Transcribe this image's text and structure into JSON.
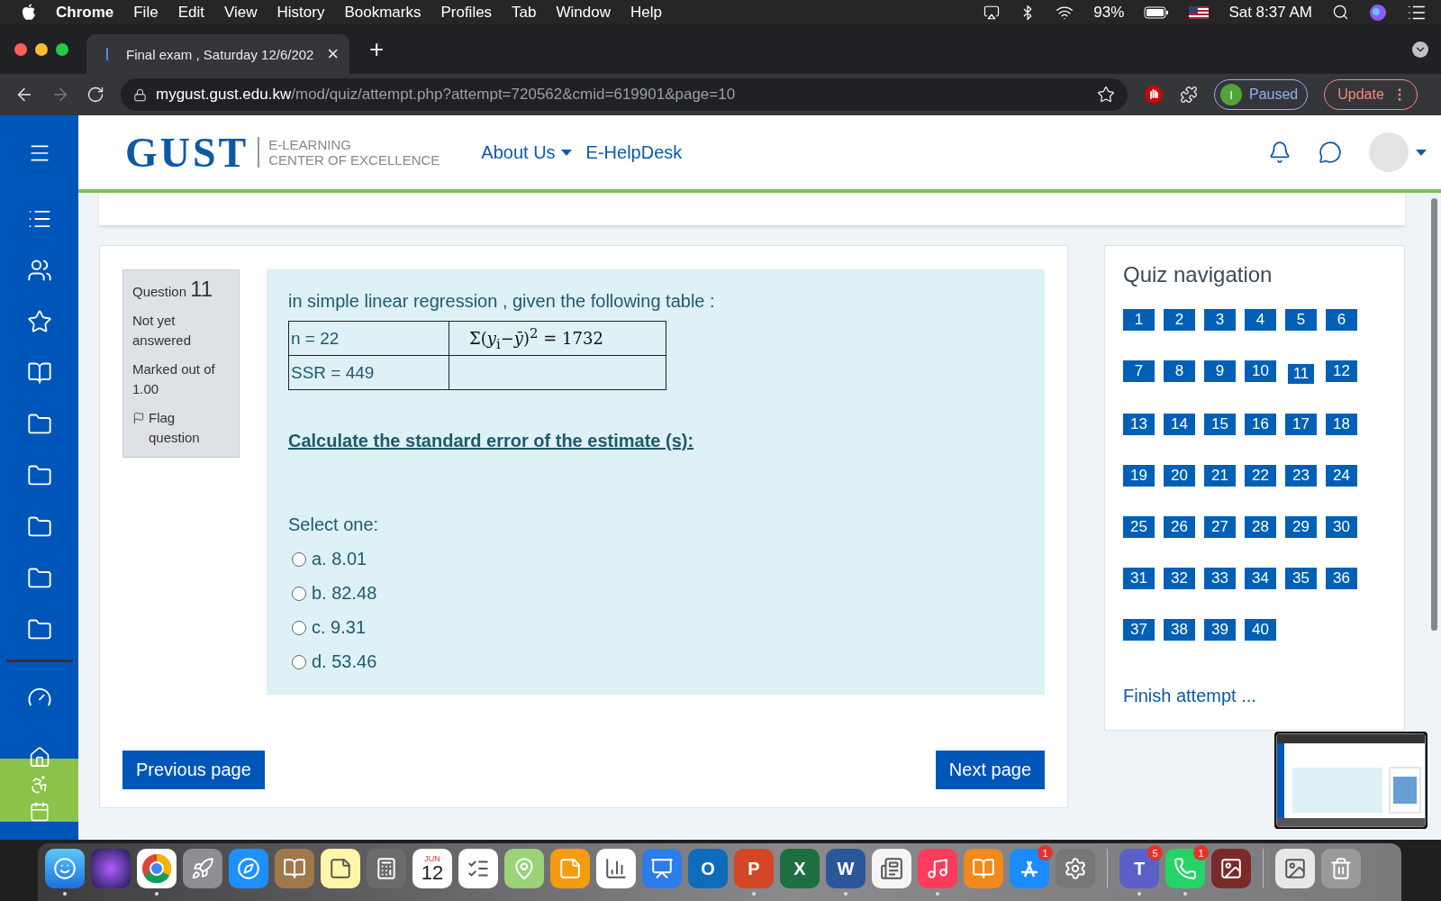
{
  "menu_bar": {
    "app": "Chrome",
    "items": [
      "File",
      "Edit",
      "View",
      "History",
      "Bookmarks",
      "Profiles",
      "Tab",
      "Window",
      "Help"
    ],
    "battery": "93%",
    "clock": "Sat 8:37 AM"
  },
  "browser": {
    "tab": {
      "title": "Final exam , Saturday 12/6/202",
      "close": "×"
    },
    "new_tab": "+",
    "url": {
      "host": "mygust.gust.edu.kw",
      "path": "/mod/quiz/attempt.php?attempt=720562&cmid=619901&page=10"
    },
    "profile": {
      "initial": "I",
      "label": "Paused"
    },
    "update": "Update"
  },
  "header": {
    "logo": "GUST",
    "tagline": [
      "E-LEARNING",
      "CENTER OF EXCELLENCE"
    ],
    "nav": [
      {
        "label": "About Us",
        "dropdown": true
      },
      {
        "label": "E-HelpDesk",
        "dropdown": false
      }
    ]
  },
  "question": {
    "label": "Question",
    "number": "11",
    "status": "Not yet answered",
    "marks": "Marked out of 1.00",
    "flag": "Flag question",
    "intro": "in simple linear regression , given the following table  :",
    "table": [
      [
        "n = 22",
        "Σ(*y*$_{i}$−*ȳ*)$^{2}$ = 1732"
      ],
      [
        "SSR = 449"
      ]
    ],
    "prompt": "Calculate the standard error of the estimate (s):",
    "select_label": "Select one:",
    "options": [
      {
        "label": "a. 8.01",
        "checked": false
      },
      {
        "label": "b. 82.48",
        "checked": false
      },
      {
        "label": "c. 9.31",
        "checked": false
      },
      {
        "label": "d. 53.46",
        "checked": false
      }
    ]
  },
  "buttons": {
    "previous": "Previous page",
    "next": "Next page"
  },
  "quiz_nav": {
    "title": "Quiz navigation",
    "questions": [
      {
        "label": "1",
        "selected": false
      },
      {
        "label": "2",
        "selected": false
      },
      {
        "label": "3",
        "selected": false
      },
      {
        "label": "4",
        "selected": false
      },
      {
        "label": "5",
        "selected": false
      },
      {
        "label": "6",
        "selected": false
      },
      {
        "label": "7",
        "selected": false
      },
      {
        "label": "8",
        "selected": false
      },
      {
        "label": "9",
        "selected": false
      },
      {
        "label": "10",
        "selected": false
      },
      {
        "label": "11",
        "selected": true
      },
      {
        "label": "12",
        "selected": false
      },
      {
        "label": "13",
        "selected": false
      },
      {
        "label": "14",
        "selected": false
      },
      {
        "label": "15",
        "selected": false
      },
      {
        "label": "16",
        "selected": false
      },
      {
        "label": "17",
        "selected": false
      },
      {
        "label": "18",
        "selected": false
      },
      {
        "label": "19",
        "selected": false
      },
      {
        "label": "20",
        "selected": false
      },
      {
        "label": "21",
        "selected": false
      },
      {
        "label": "22",
        "selected": false
      },
      {
        "label": "23",
        "selected": false
      },
      {
        "label": "24",
        "selected": false
      },
      {
        "label": "25",
        "selected": false
      },
      {
        "label": "26",
        "selected": false
      },
      {
        "label": "27",
        "selected": false
      },
      {
        "label": "28",
        "selected": false
      },
      {
        "label": "29",
        "selected": false
      },
      {
        "label": "30",
        "selected": false
      },
      {
        "label": "31",
        "selected": false
      },
      {
        "label": "32",
        "selected": false
      },
      {
        "label": "33",
        "selected": false
      },
      {
        "label": "34",
        "selected": false
      },
      {
        "label": "35",
        "selected": false
      },
      {
        "label": "36",
        "selected": false
      },
      {
        "label": "37",
        "selected": false
      },
      {
        "label": "38",
        "selected": false
      },
      {
        "label": "39",
        "selected": false
      },
      {
        "label": "40",
        "selected": false
      }
    ],
    "finish": "Finish attempt ..."
  },
  "dock": [
    {
      "kind": "finder",
      "running": true
    },
    {
      "kind": "siri",
      "running": false
    },
    {
      "kind": "chrome",
      "running": true
    },
    {
      "kind": "launchpad",
      "running": false
    },
    {
      "kind": "safari",
      "running": false
    },
    {
      "kind": "contacts",
      "running": false
    },
    {
      "kind": "notes",
      "running": false
    },
    {
      "kind": "calculator",
      "running": false
    },
    {
      "kind": "calendar",
      "running": false,
      "month": "JUN",
      "day": "12"
    },
    {
      "kind": "reminders",
      "running": false
    },
    {
      "kind": "maps",
      "running": false
    },
    {
      "kind": "pages",
      "running": false
    },
    {
      "kind": "numbers",
      "running": false
    },
    {
      "kind": "keynote",
      "running": false
    },
    {
      "kind": "outlook",
      "running": false,
      "letter": "O"
    },
    {
      "kind": "powerpoint",
      "running": true,
      "letter": "P"
    },
    {
      "kind": "excel",
      "running": false,
      "letter": "X"
    },
    {
      "kind": "word",
      "running": true,
      "letter": "W"
    },
    {
      "kind": "news",
      "running": false
    },
    {
      "kind": "music",
      "running": true
    },
    {
      "kind": "books",
      "running": false
    },
    {
      "kind": "appstore",
      "running": false,
      "badge": "1"
    },
    {
      "kind": "settings",
      "running": false
    },
    {
      "kind": "separator"
    },
    {
      "kind": "teams",
      "running": true,
      "letter": "T",
      "badge": "5"
    },
    {
      "kind": "whatsapp",
      "running": true,
      "badge": "1"
    },
    {
      "kind": "photos",
      "running": false
    },
    {
      "kind": "separator"
    },
    {
      "kind": "preview",
      "running": false
    },
    {
      "kind": "trash",
      "running": false
    }
  ]
}
